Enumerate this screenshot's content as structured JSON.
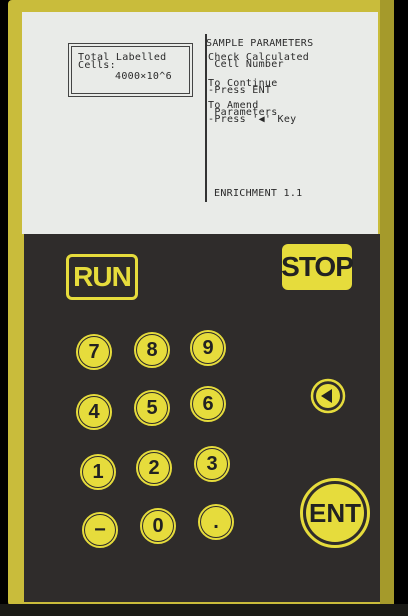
{
  "screen": {
    "cells_label_line1": "Total Labelled",
    "cells_label_line2": "Cells:",
    "cells_value": "4000×10^6",
    "title": "SAMPLE PARAMETERS",
    "line1": "Check Calculated",
    "line2": " Cell Number",
    "line3": "To Continue",
    "line4": "-Press ENT",
    "line5": "To Amend",
    "line6": " Parameters",
    "line7": "-Press '◀' Key",
    "mode": "ENRICHMENT 1.1"
  },
  "keypad": {
    "run_label": "RUN",
    "stop_label": "STOP",
    "ent_label": "ENT",
    "back_icon": "left-arrow-icon",
    "digits": [
      "7",
      "8",
      "9",
      "4",
      "5",
      "6",
      "1",
      "2",
      "3",
      "−",
      "0",
      "."
    ]
  },
  "colors": {
    "housing": "#c9bc3b",
    "key_yellow": "#e6dc3c",
    "panel": "#2f2c2b",
    "lcd": "#e9ebe8"
  }
}
